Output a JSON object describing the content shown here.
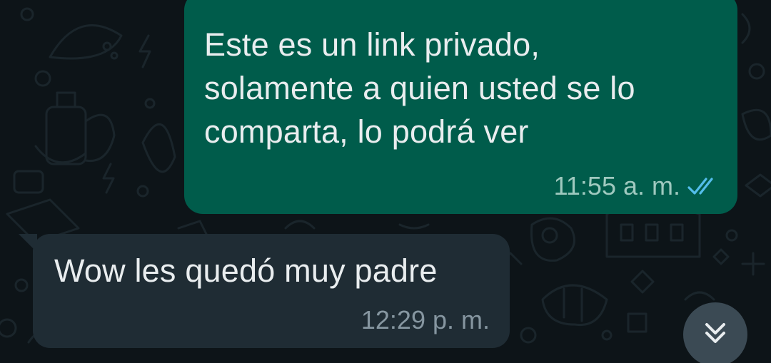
{
  "messages": [
    {
      "direction": "outgoing",
      "text": "Este es un link privado,\nsolamente a quien usted se lo\ncomparta, lo podrá ver",
      "time": "11:55 a. m.",
      "status_icon": "double-check-read-icon",
      "bubble_color": "#005c4b",
      "tick_color": "#53bdeb"
    },
    {
      "direction": "incoming",
      "text": "Wow les quedó muy padre",
      "time": "12:29 p. m.",
      "bubble_color": "#1f2c34"
    }
  ],
  "scroll_button": {
    "icon": "double-chevron-down-icon"
  },
  "colors": {
    "background": "#0d1418",
    "text": "#e9edef"
  }
}
